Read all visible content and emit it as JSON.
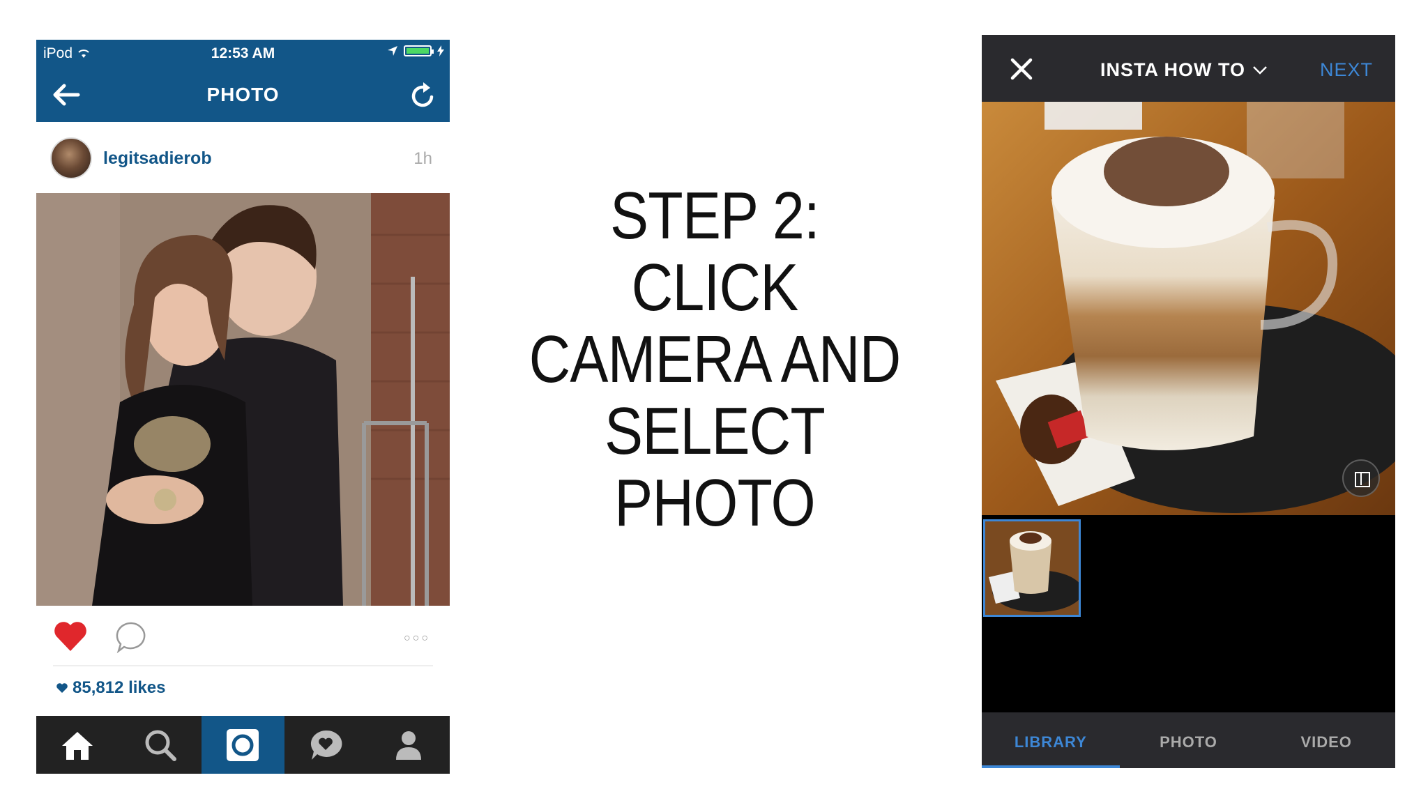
{
  "left_phone": {
    "status_bar": {
      "carrier": "iPod",
      "time": "12:53 AM"
    },
    "nav": {
      "title": "PHOTO"
    },
    "post": {
      "username": "legitsadierob",
      "time": "1h",
      "likes": "85,812 likes"
    },
    "tabs": [
      "home-icon",
      "search-icon",
      "camera-icon",
      "activity-icon",
      "profile-icon"
    ],
    "active_tab": "camera-icon"
  },
  "instruction": {
    "lines": [
      "STEP 2:",
      "CLICK",
      "CAMERA AND",
      "SELECT",
      "PHOTO"
    ]
  },
  "right_phone": {
    "header": {
      "title": "INSTA HOW TO",
      "next": "NEXT"
    },
    "tabs": [
      "LIBRARY",
      "PHOTO",
      "VIDEO"
    ],
    "active_tab": "LIBRARY",
    "colors": {
      "accent": "#3d87d6",
      "bar": "#2a2a2e"
    }
  },
  "colors": {
    "instagram_blue": "#125688",
    "heart_red": "#e0272c"
  }
}
